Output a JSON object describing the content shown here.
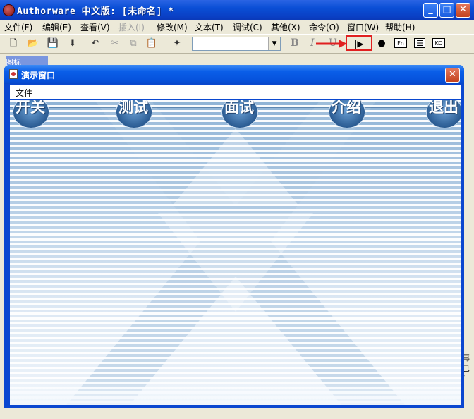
{
  "app": {
    "title": "Authorware  中文版: [未命名] *"
  },
  "menu": [
    {
      "label": "文件(F)",
      "enabled": true
    },
    {
      "label": "编辑(E)",
      "enabled": true
    },
    {
      "label": "查看(V)",
      "enabled": true
    },
    {
      "label": "插入(I)",
      "enabled": false
    },
    {
      "label": "修改(M)",
      "enabled": true
    },
    {
      "label": "文本(T)",
      "enabled": true
    },
    {
      "label": "调试(C)",
      "enabled": true
    },
    {
      "label": "其他(X)",
      "enabled": true
    },
    {
      "label": "命令(O)",
      "enabled": true
    },
    {
      "label": "窗口(W)",
      "enabled": true
    },
    {
      "label": "帮助(H)",
      "enabled": true
    }
  ],
  "toolbar": {
    "bold_label": "B",
    "italic_label": "I",
    "underline_label": "U",
    "box1_label": "Fn",
    "box2_label": "KO"
  },
  "background": {
    "palette_title": "图标",
    "right_fragment": [
      "再",
      "已",
      "生"
    ]
  },
  "presentation": {
    "title": "演示窗口",
    "menu_label": "文件",
    "nav_buttons": [
      "开关",
      "测试",
      "面试",
      "介绍",
      "退出"
    ]
  },
  "colors": {
    "titlebar": "#0a4fd6",
    "highlight": "#e02020",
    "stage": "#b7cfe6"
  }
}
